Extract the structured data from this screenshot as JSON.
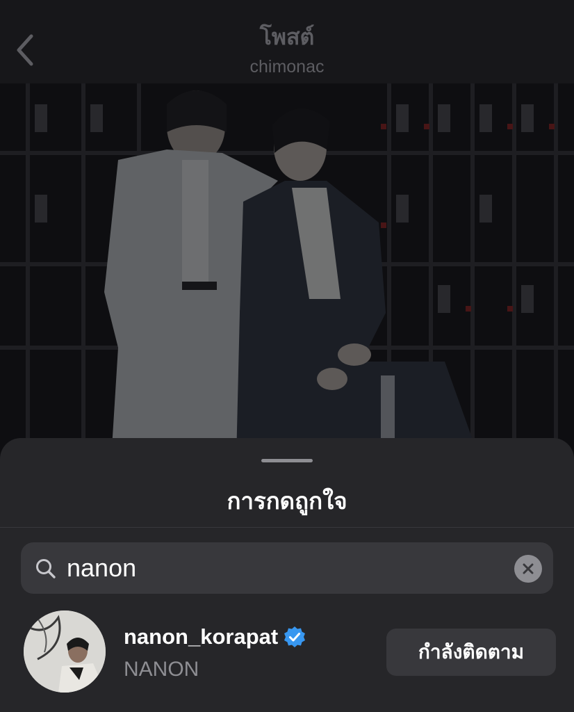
{
  "header": {
    "title": "โพสต์",
    "subtitle": "chimonac",
    "back_icon": "chevron-left-icon"
  },
  "post": {
    "image_icon": "photo"
  },
  "sheet": {
    "title": "การกดถูกใจ"
  },
  "search": {
    "icon": "search-icon",
    "value": "nanon",
    "clear_icon": "clear-icon"
  },
  "results": [
    {
      "username": "nanon_korapat",
      "verified": true,
      "full_name": "NANON",
      "button_label": "กำลังติดตาม"
    }
  ],
  "colors": {
    "background": "#141416",
    "sheet": "#262629",
    "field": "#38383c",
    "secondary_text": "#8e8e93",
    "verified_blue": "#3897f0",
    "header_text": "#5d5d62"
  }
}
